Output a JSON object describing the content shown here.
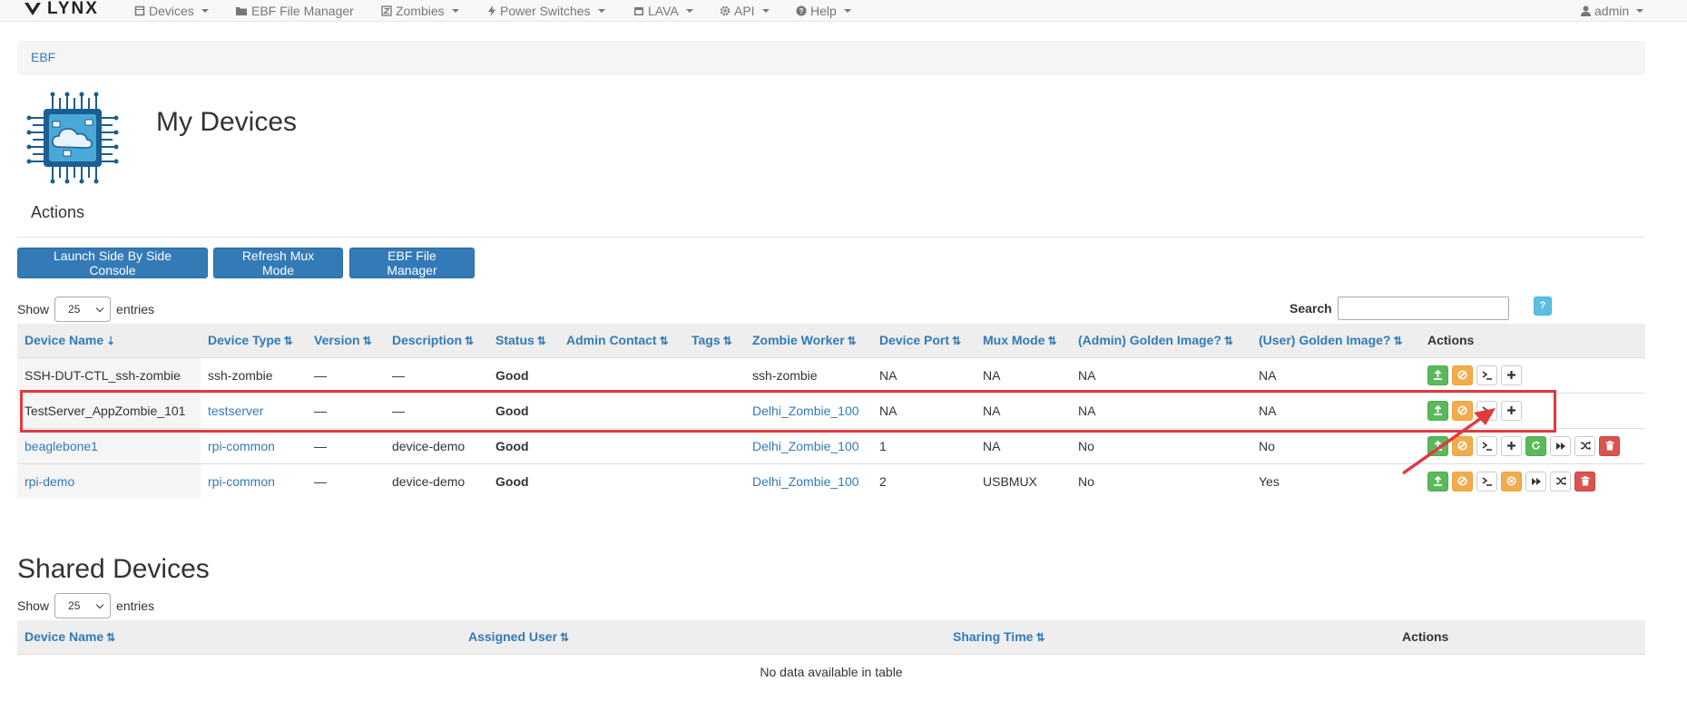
{
  "nav": {
    "brand": "LYNX",
    "items": [
      {
        "key": "devices",
        "label": "Devices",
        "icon": "cube-icon"
      },
      {
        "key": "ebf",
        "label": "EBF File Manager",
        "icon": "folder-icon"
      },
      {
        "key": "zombies",
        "label": "Zombies",
        "icon": "zombie-icon"
      },
      {
        "key": "power",
        "label": "Power Switches",
        "icon": "bolt-icon"
      },
      {
        "key": "lava",
        "label": "LAVA",
        "icon": "calendar-icon"
      },
      {
        "key": "api",
        "label": "API",
        "icon": "gear-icon"
      },
      {
        "key": "help",
        "label": "Help",
        "icon": "question-circle-icon"
      }
    ],
    "user": "admin"
  },
  "breadcrumb": "EBF",
  "page_title": "My Devices",
  "actions_heading": "Actions",
  "action_buttons": [
    "Launch Side By Side Console",
    "Refresh Mux Mode",
    "EBF File Manager"
  ],
  "table_controls": {
    "show_label": "Show",
    "entries_label": "entries",
    "page_length": "25",
    "search_label": "Search",
    "help": "?"
  },
  "my_devices": {
    "columns": [
      "Device Name",
      "Device Type",
      "Version",
      "Description",
      "Status",
      "Admin Contact",
      "Tags",
      "Zombie Worker",
      "Device Port",
      "Mux Mode",
      "(Admin) Golden Image?",
      "(User) Golden Image?",
      "Actions"
    ],
    "rows": [
      {
        "name": "SSH-DUT-CTL_ssh-zombie",
        "name_link": false,
        "type": "ssh-zombie",
        "type_link": false,
        "version": "—",
        "description": "—",
        "status": "Good",
        "admin_contact": "",
        "tags": "",
        "zombie_worker": "ssh-zombie",
        "zombie_link": false,
        "port": "NA",
        "mux": "NA",
        "admin_golden": "NA",
        "user_golden": "NA",
        "actions": [
          "upload",
          "disable",
          "console",
          "add"
        ]
      },
      {
        "name": "TestServer_AppZombie_101",
        "name_link": false,
        "type": "testserver",
        "type_link": true,
        "version": "—",
        "description": "—",
        "status": "Good",
        "admin_contact": "",
        "tags": "",
        "zombie_worker": "Delhi_Zombie_100",
        "zombie_link": true,
        "port": "NA",
        "mux": "NA",
        "admin_golden": "NA",
        "user_golden": "NA",
        "actions": [
          "upload",
          "disable",
          "console",
          "add"
        ]
      },
      {
        "name": "beaglebone1",
        "name_link": true,
        "type": "rpi-common",
        "type_link": true,
        "version": "—",
        "description": "device-demo",
        "status": "Good",
        "admin_contact": "",
        "tags": "",
        "zombie_worker": "Delhi_Zombie_100",
        "zombie_link": true,
        "port": "1",
        "mux": "NA",
        "admin_golden": "No",
        "user_golden": "No",
        "actions": [
          "upload",
          "disable",
          "console",
          "add",
          "refresh",
          "forward",
          "shuffle",
          "delete"
        ]
      },
      {
        "name": "rpi-demo",
        "name_link": true,
        "type": "rpi-common",
        "type_link": true,
        "version": "—",
        "description": "device-demo",
        "status": "Good",
        "admin_contact": "",
        "tags": "",
        "zombie_worker": "Delhi_Zombie_100",
        "zombie_link": true,
        "port": "2",
        "mux": "USBMUX",
        "admin_golden": "No",
        "user_golden": "Yes",
        "actions": [
          "upload",
          "disable",
          "console",
          "cancel",
          "forward",
          "shuffle",
          "delete"
        ]
      }
    ]
  },
  "shared_title": "Shared Devices",
  "shared_devices": {
    "columns": [
      "Device Name",
      "Assigned User",
      "Sharing Time",
      "Actions"
    ],
    "empty_message": "No data available in table"
  },
  "colors": {
    "primary": "#337ab7",
    "success": "#5cb85c",
    "warning": "#f0ad4e",
    "danger": "#d9534f",
    "highlight": "#e03a3e"
  }
}
